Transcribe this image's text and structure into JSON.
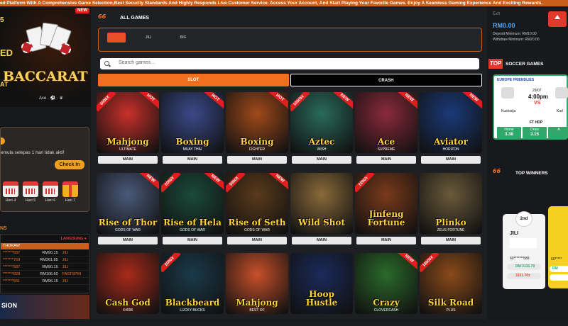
{
  "marquee": "ed Platform With A Comprehensive Game Selection,Best Security Standards And Highly Responds Live Customer Service. Access Your Account, And Start Playing Your Favorite Games. Enjoy A Seamless Gaming Experience And Exciting Rewards.",
  "left": {
    "banner": {
      "new_badge": "NEW",
      "word_ed": "ED",
      "word_at": "AT",
      "title": "BACCARAT",
      "num5": "5",
      "logos": "Ace · ⚽ · ♛"
    },
    "checkin": {
      "text": "emula selepas 1 hari tidak aktif",
      "button": "Check In",
      "days": [
        {
          "label": "Hari 4"
        },
        {
          "label": "Hari 5"
        },
        {
          "label": "Hari 6"
        },
        {
          "label": "Hari 7"
        }
      ]
    },
    "section_label": "NS",
    "withdraw": {
      "header": "THDRAW",
      "live": "LANGSUNG ●",
      "rows": [
        {
          "user": "*******837",
          "amount": "RM90.15",
          "game": "JILI"
        },
        {
          "user": "*******769",
          "amount": "RM261.85",
          "game": "JILI"
        },
        {
          "user": "*******587",
          "amount": "RM90.15",
          "game": "JILI"
        },
        {
          "user": "*******828",
          "amount": "RM106.60",
          "game": "FASTSPIN"
        },
        {
          "user": "*******561",
          "amount": "RM96.15",
          "game": "JILI"
        }
      ]
    },
    "promo": {
      "text": "SION"
    }
  },
  "main": {
    "logo": "ACE",
    "logo_suffix": "66",
    "all_games": "ALL GAMES",
    "providers": [
      "",
      "JILI",
      "BIG",
      "",
      "",
      "",
      "",
      "",
      "",
      ""
    ],
    "search_placeholder": "Search games ..",
    "tabs": {
      "slot": "SLOT",
      "crash": "CRASH"
    },
    "games": [
      {
        "title": "Mahjong",
        "sub": "ULTIMATE",
        "tag": "HOT",
        "mult": "5000X",
        "btn": "MAIN",
        "bg": "#c8302a"
      },
      {
        "title": "Boxing",
        "sub": "MUAY THAI",
        "tag": "HOT",
        "mult": "",
        "btn": "MAIN",
        "bg": "#3a4a8a"
      },
      {
        "title": "Boxing",
        "sub": "FIGHTER",
        "tag": "HOT",
        "mult": "",
        "btn": "MAIN",
        "bg": "#a04a1a"
      },
      {
        "title": "Aztec",
        "sub": "WISH",
        "tag": "NEW",
        "mult": "10000X",
        "btn": "MAIN",
        "bg": "#2a6a5a"
      },
      {
        "title": "Ace",
        "sub": "SUPREME",
        "tag": "NEW",
        "mult": "",
        "btn": "MAIN",
        "bg": "#8a2a3a"
      },
      {
        "title": "Aviator",
        "sub": "HORIZON",
        "tag": "NEW",
        "mult": "",
        "btn": "MAIN",
        "bg": "#1a3a7a"
      },
      {
        "title": "Rise of Thor",
        "sub": "GODS OF WAR",
        "tag": "NEW",
        "mult": "",
        "btn": "MAIN",
        "bg": "#4a5a7a"
      },
      {
        "title": "Rise of Hela",
        "sub": "GODS OF WAR",
        "tag": "NEW",
        "mult": "5000X",
        "btn": "MAIN",
        "bg": "#1a4a3a"
      },
      {
        "title": "Rise of Seth",
        "sub": "GODS OF WAR",
        "tag": "NEW",
        "mult": "5000X",
        "btn": "MAIN",
        "bg": "#5a3a1a"
      },
      {
        "title": "Wild Shot",
        "sub": "",
        "tag": "",
        "mult": "",
        "btn": "MAIN",
        "bg": "#8a6a3a"
      },
      {
        "title": "Jinfeng Fortune",
        "sub": "",
        "tag": "",
        "mult": "5200X",
        "btn": "MAIN",
        "bg": "#7a3a1a"
      },
      {
        "title": "Plinko",
        "sub": "ZEUS FORTUNE",
        "tag": "",
        "mult": "",
        "btn": "MAIN",
        "bg": "#6a5a3a"
      },
      {
        "title": "Cash God",
        "sub": "X4096",
        "tag": "",
        "mult": "",
        "btn": "",
        "bg": "#a82a1a"
      },
      {
        "title": "Blackbeard",
        "sub": "LUCKY BUCKS",
        "tag": "",
        "mult": "5000X",
        "btn": "",
        "bg": "#1a3a4a"
      },
      {
        "title": "Mahjong",
        "sub": "BEST OF",
        "tag": "",
        "mult": "",
        "btn": "",
        "bg": "#c8502a"
      },
      {
        "title": "Hoop Hustle",
        "sub": "",
        "tag": "",
        "mult": "",
        "btn": "",
        "bg": "#1a2a5a"
      },
      {
        "title": "Crazy",
        "sub": "CLOVERCASH",
        "tag": "NEW",
        "mult": "",
        "btn": "",
        "bg": "#2a6a2a"
      },
      {
        "title": "Silk Road",
        "sub": "PLUS",
        "tag": "",
        "mult": "10000X",
        "btn": "",
        "bg": "#8a4a1a"
      }
    ]
  },
  "right": {
    "exit": "Exit",
    "balance": "RM0.00",
    "deposit_min": "Deposit Minimum: RM10.00",
    "withdraw_min": "Withdraw Minimum: RM20.00",
    "top_badge": "TOP",
    "soccer_title": "SOCCER GAMES",
    "match": {
      "league": "EUROPE FRIENDLIES",
      "date": "29/07",
      "time": "4:00pm",
      "vs": "VS",
      "team_a": "Kustosija",
      "team_b": "Karl",
      "ft": "FT HDP",
      "odds": [
        {
          "label": "Home",
          "value": "3.38"
        },
        {
          "label": "Draw",
          "value": "3.15"
        },
        {
          "label": "A",
          "value": ""
        }
      ]
    },
    "top_winners": "TOP WINNERS",
    "winner": {
      "rank": "2nd",
      "game": "JILI",
      "user": "60*******589",
      "amount": "RM 3131.70",
      "amount2": "3131.70x"
    },
    "winner2": {
      "user": "60*****",
      "amount": "RM",
      "amount2": ""
    }
  },
  "colors": {
    "accent": "#f07020",
    "bg": "#1e1f22",
    "live": "#e23a3a",
    "green": "#2fa86b"
  }
}
